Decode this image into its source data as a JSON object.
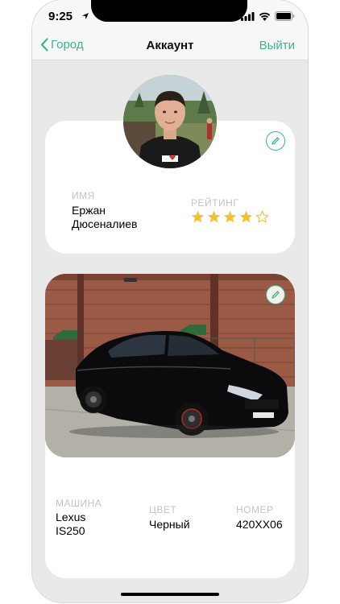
{
  "status_bar": {
    "time": "9:25",
    "icons": [
      "location-icon",
      "signal-icon",
      "wifi-icon",
      "battery-icon"
    ]
  },
  "nav": {
    "back_label": "Город",
    "title": "Аккаунт",
    "logout_label": "Выйти"
  },
  "profile": {
    "name_label": "ИМЯ",
    "name_value": "Ержан Дюсеналиев",
    "rating_label": "РЕЙТИНГ",
    "rating_value": 4,
    "rating_max": 5
  },
  "car": {
    "make_label": "МАШИНА",
    "make_value": "Lexus IS250",
    "color_label": "ЦВЕТ",
    "color_value": "Черный",
    "plate_label": "НОМЕР",
    "plate_value": "420XX06"
  },
  "colors": {
    "accent": "#3bb58d",
    "star": "#f2c12e",
    "label": "#c3c3c3",
    "background": "#e9e9ea"
  }
}
